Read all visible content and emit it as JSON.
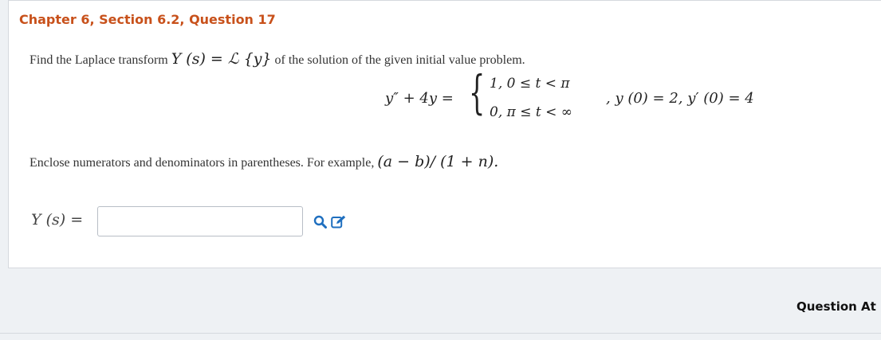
{
  "header": {
    "chapter_title": "Chapter 6, Section 6.2, Question 17"
  },
  "question": {
    "prompt_text": "Find the Laplace transform ",
    "prompt_math": "Y (s) = ℒ {y}",
    "prompt_tail": " of the solution of the given initial value problem.",
    "ode_left": "y″ + 4y =",
    "case1": "1, 0 ≤ t < π",
    "case2": "0, π ≤ t < ∞",
    "initial_conditions": ", y (0) = 2, y′ (0) = 4",
    "enclose_text": "Enclose numerators and denominators in parentheses. For example, ",
    "enclose_example": "(a − b)/ (1 + n).",
    "answer_label": "Y (s) =",
    "answer_value": ""
  },
  "icons": {
    "preview": "search-icon",
    "edit": "edit-icon"
  },
  "footer": {
    "question_attempts_label": "Question At"
  },
  "colors": {
    "accent": "#c8511b",
    "link": "#1f6fbf"
  }
}
